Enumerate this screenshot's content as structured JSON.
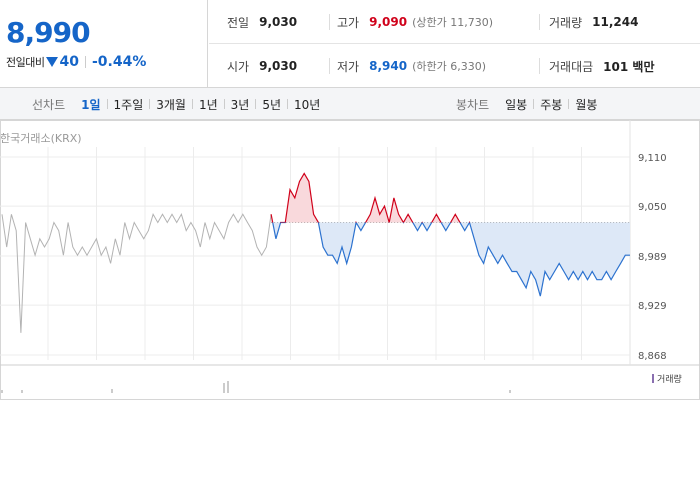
{
  "quote": {
    "price": "8,990",
    "change_label": "전일대비",
    "change_amount": "40",
    "change_percent": "-0.44%",
    "colors": {
      "down": "#1565c8",
      "up": "#d0021b"
    }
  },
  "stats": {
    "prev_close": {
      "label": "전일",
      "value": "9,030"
    },
    "high": {
      "label": "고가",
      "value": "9,090",
      "sub": "(상한가 11,730)"
    },
    "volume": {
      "label": "거래량",
      "value": "11,244"
    },
    "open": {
      "label": "시가",
      "value": "9,030"
    },
    "low": {
      "label": "저가",
      "value": "8,940",
      "sub": "(하한가 6,330)"
    },
    "amount": {
      "label": "거래대금",
      "value": "101 백만"
    }
  },
  "tabs": {
    "line_title": "선차트",
    "line_items": [
      "1일",
      "1주일",
      "3개월",
      "1년",
      "3년",
      "5년",
      "10년"
    ],
    "line_active": 0,
    "candle_title": "봉차트",
    "candle_items": [
      "일봉",
      "주봉",
      "월봉"
    ]
  },
  "chart_data": {
    "type": "line",
    "source": "한국거래소(KRX)",
    "reference_value": 9030,
    "y_ticks": [
      "9,110",
      "9,050",
      "8,989",
      "8,929",
      "8,868"
    ],
    "ylim": [
      8868,
      9110
    ],
    "series": [
      {
        "values": [
          9040,
          9000,
          9040,
          9020,
          8895,
          9030,
          9010,
          8990,
          9010,
          9000,
          9010,
          9030,
          9020,
          8990,
          9030,
          9000,
          8990,
          9000,
          8990,
          9000,
          9010,
          8990,
          9000,
          8980,
          9010,
          8990,
          9030,
          9010,
          9030,
          9020,
          9010,
          9020,
          9040,
          9030,
          9040,
          9030,
          9040,
          9030,
          9040,
          9020,
          9030,
          9020,
          9000,
          9030,
          9010,
          9030,
          9020,
          9010,
          9030,
          9040,
          9030,
          9040,
          9030,
          9020,
          9000,
          8990,
          9000,
          9040,
          9010,
          9030,
          9030,
          9070,
          9060,
          9080,
          9090,
          9080,
          9040,
          9030,
          9000,
          8990,
          8990,
          8980,
          9000,
          8980,
          9000,
          9030,
          9020,
          9030,
          9040,
          9060,
          9040,
          9050,
          9030,
          9060,
          9040,
          9030,
          9040,
          9030,
          9020,
          9030,
          9020,
          9030,
          9040,
          9030,
          9020,
          9030,
          9040,
          9030,
          9020,
          9030,
          9010,
          8990,
          8980,
          9000,
          8990,
          8980,
          8990,
          8980,
          8970,
          8970,
          8960,
          8950,
          8970,
          8960,
          8940,
          8970,
          8960,
          8970,
          8980,
          8970,
          8960,
          8970,
          8960,
          8970,
          8960,
          8970,
          8960,
          8960,
          8970,
          8960,
          8970,
          8980,
          8990,
          8990
        ]
      }
    ],
    "volume_label": "거래량"
  }
}
